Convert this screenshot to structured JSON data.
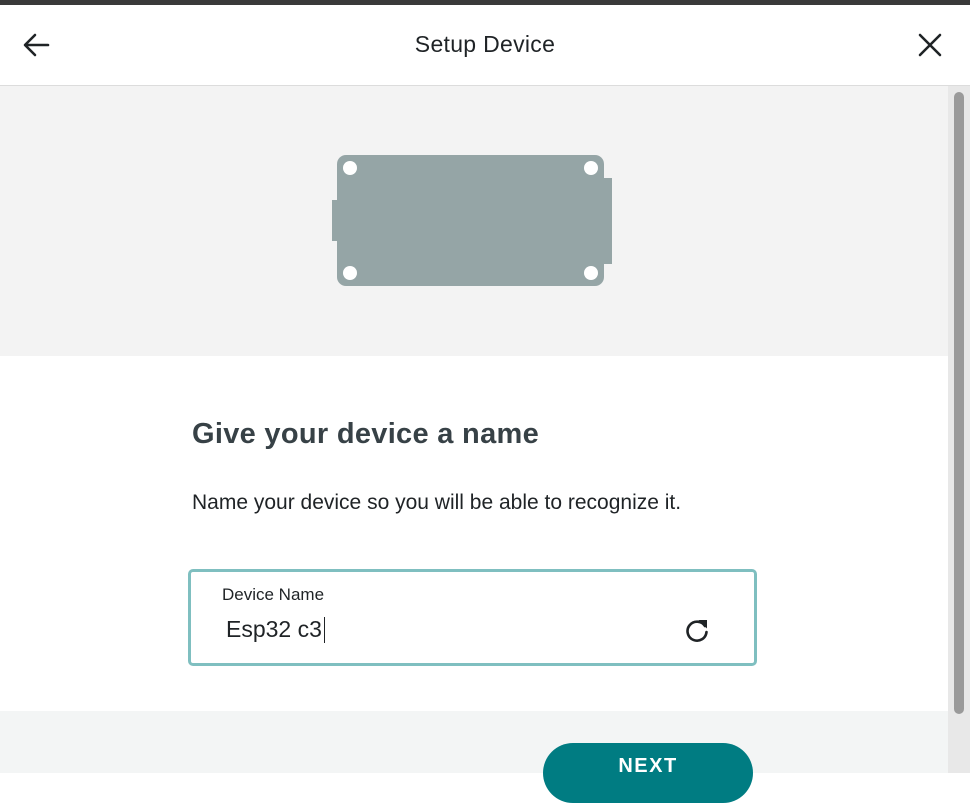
{
  "header": {
    "title": "Setup Device",
    "back_icon": "arrow-left-icon",
    "close_icon": "close-icon"
  },
  "illustration": {
    "icon": "device-board-icon",
    "color": "#95a5a6"
  },
  "content": {
    "heading": "Give your device a name",
    "description": "Name your device so you will be able to recognize it."
  },
  "device_name_field": {
    "label": "Device Name",
    "value": "Esp32 c3",
    "refresh_icon": "refresh-icon"
  },
  "footer": {
    "next_label": "NEXT"
  },
  "colors": {
    "accent": "#007c82",
    "field_border": "#7fbfc0",
    "hero_bg": "#f3f3f3"
  }
}
